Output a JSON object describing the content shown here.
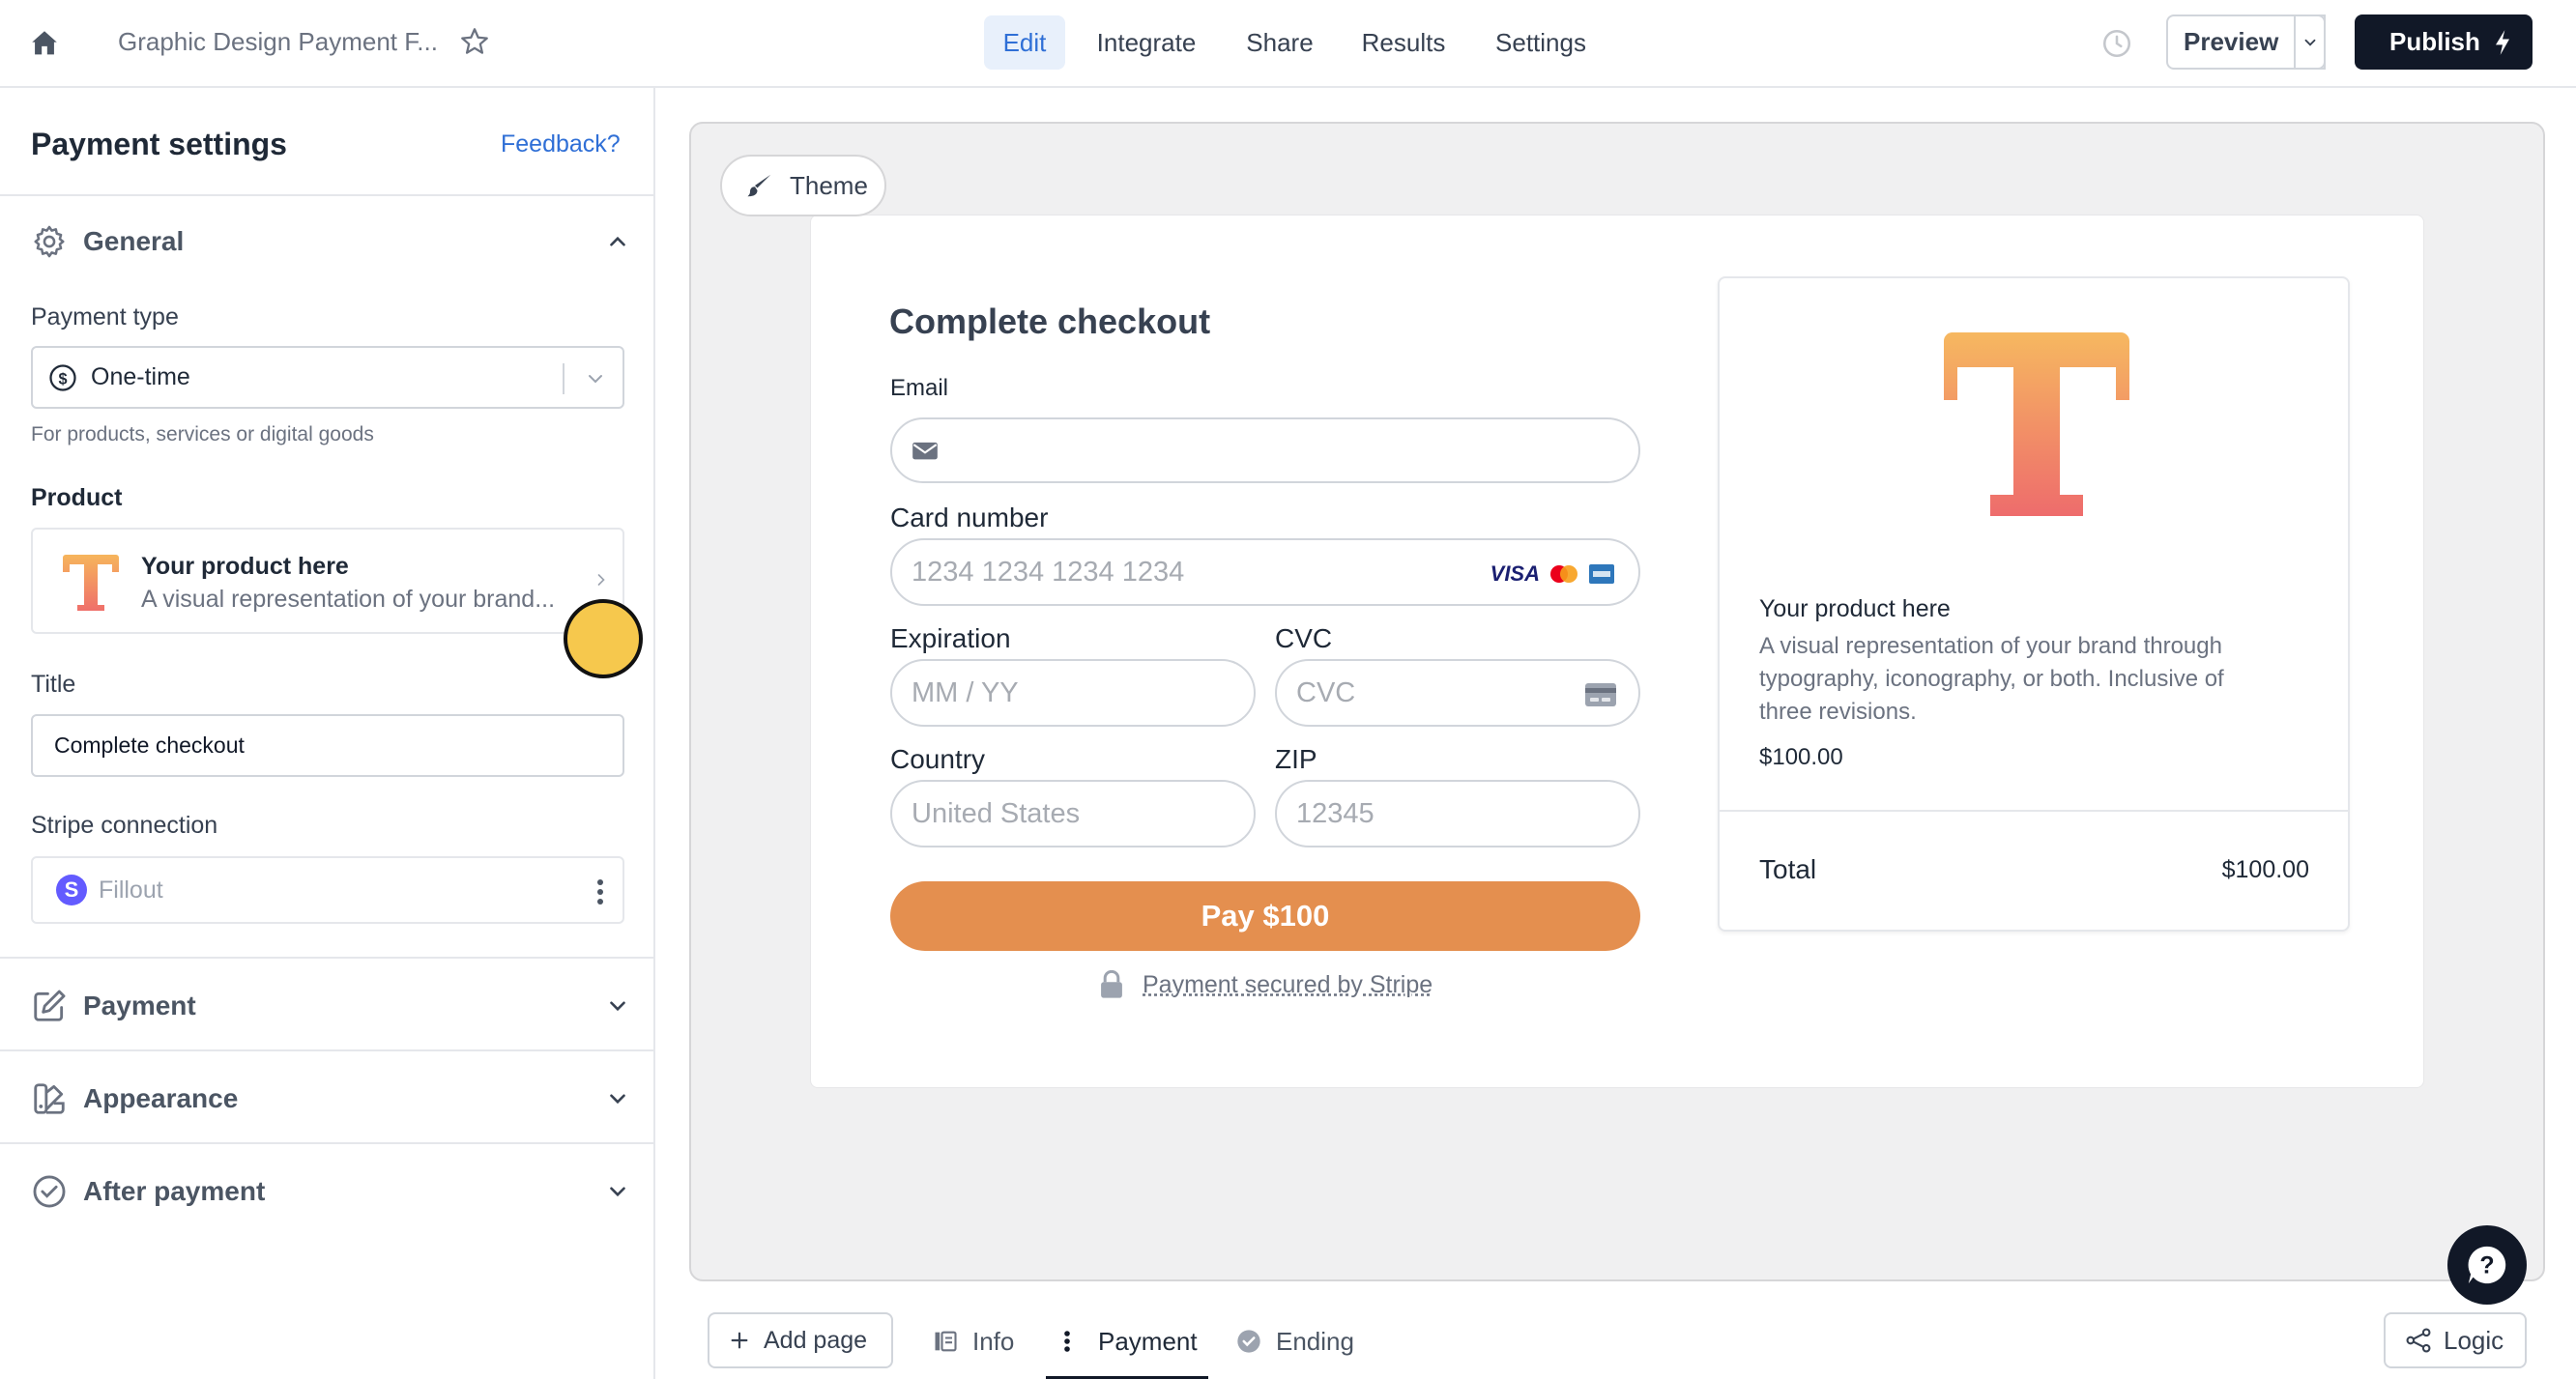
{
  "topbar": {
    "doc_title": "Graphic Design Payment F...",
    "tabs": [
      {
        "label": "Edit",
        "active": true
      },
      {
        "label": "Integrate",
        "active": false
      },
      {
        "label": "Share",
        "active": false
      },
      {
        "label": "Results",
        "active": false
      },
      {
        "label": "Settings",
        "active": false
      }
    ],
    "preview_label": "Preview",
    "publish_label": "Publish"
  },
  "panel": {
    "title": "Payment settings",
    "feedback_label": "Feedback?",
    "general": {
      "label": "General",
      "expanded": true,
      "payment_type_label": "Payment type",
      "payment_type_value": "One-time",
      "payment_type_helper": "For products, services or digital goods",
      "product_label": "Product",
      "product_name": "Your product here",
      "product_desc": "A visual representation of your brand...",
      "title_label": "Title",
      "title_value": "Complete checkout",
      "stripe_label": "Stripe connection",
      "stripe_value": "Fillout"
    },
    "sections": [
      {
        "label": "Payment",
        "icon": "edit-icon"
      },
      {
        "label": "Appearance",
        "icon": "palette-icon"
      },
      {
        "label": "After payment",
        "icon": "check-circle-icon"
      }
    ]
  },
  "canvas": {
    "theme_label": "Theme",
    "form": {
      "title": "Complete checkout",
      "email_label": "Email",
      "card_label": "Card number",
      "card_placeholder": "1234 1234 1234 1234",
      "expiration_label": "Expiration",
      "expiration_placeholder": "MM / YY",
      "cvc_label": "CVC",
      "cvc_placeholder": "CVC",
      "country_label": "Country",
      "country_placeholder": "United States",
      "zip_label": "ZIP",
      "zip_placeholder": "12345",
      "pay_label": "Pay $100",
      "secured_label": "Payment secured by Stripe",
      "visa_text": "VISA"
    },
    "summary": {
      "product_name": "Your product here",
      "product_desc": "A visual representation of your brand through typography, iconography, or both. Inclusive of three revisions.",
      "price": "$100.00",
      "total_label": "Total",
      "total_value": "$100.00"
    }
  },
  "bottombar": {
    "add_page_label": "Add page",
    "pages": [
      {
        "label": "Info",
        "icon": "page-icon"
      },
      {
        "label": "Payment",
        "icon": "kebab-icon",
        "active": true
      },
      {
        "label": "Ending",
        "icon": "check-circle-icon"
      }
    ],
    "logic_label": "Logic"
  },
  "colors": {
    "accent": "#2f6fd6",
    "pay_button": "#e48f4f",
    "publish_bg": "#111827",
    "cursor_marker": "#f6c84d"
  }
}
